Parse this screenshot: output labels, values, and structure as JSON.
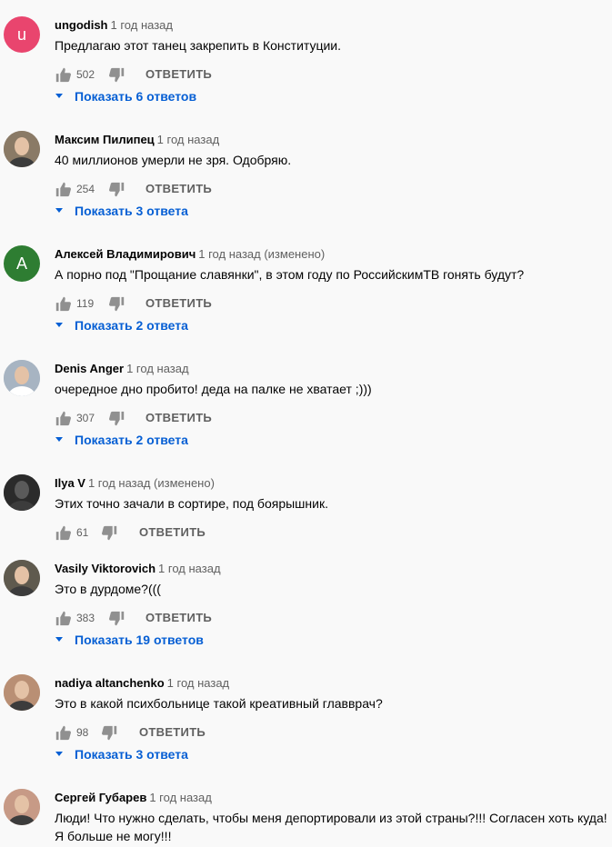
{
  "comments": [
    {
      "author": "ungodish",
      "time": "1 год назад",
      "text": "Предлагаю этот танец закрепить в Конституции.",
      "likes": "502",
      "reply": "ОТВЕТИТЬ",
      "replies_label": "Показать 6 ответов",
      "avatar_letter": "u",
      "avatar_color": "#e9456e"
    },
    {
      "author": "Максим Пилипец",
      "time": "1 год назад",
      "text": "40 миллионов умерли не зря. Одобряю.",
      "likes": "254",
      "reply": "ОТВЕТИТЬ",
      "replies_label": "Показать 3 ответа",
      "avatar_letter": "",
      "avatar_color": "#8a7a66"
    },
    {
      "author": "Алексей Владимирович",
      "time": "1 год назад (изменено)",
      "text": "А порно под \"Прощание славянки\", в этом году по РоссийскимТВ гонять будут?",
      "likes": "119",
      "reply": "ОТВЕТИТЬ",
      "replies_label": "Показать 2 ответа",
      "avatar_letter": "A",
      "avatar_color": "#2e7d32"
    },
    {
      "author": "Denis Anger",
      "time": "1 год назад",
      "text": "очередное дно пробито! деда на палке не хватает ;)))",
      "likes": "307",
      "reply": "ОТВЕТИТЬ",
      "replies_label": "Показать 2 ответа",
      "avatar_letter": "",
      "avatar_color": "#a7b4c2"
    },
    {
      "author": "Ilya V",
      "time": "1 год назад (изменено)",
      "text": "Этих точно зачали в сортире, под боярышник.",
      "likes": "61",
      "reply": "ОТВЕТИТЬ",
      "replies_label": "",
      "avatar_letter": "",
      "avatar_color": "#2b2b2b"
    },
    {
      "author": "Vasily Viktorovich",
      "time": "1 год назад",
      "text": "Это в дурдоме?(((",
      "likes": "383",
      "reply": "ОТВЕТИТЬ",
      "replies_label": "Показать 19 ответов",
      "avatar_letter": "",
      "avatar_color": "#5f5a4e"
    },
    {
      "author": "nadiya altanchenko",
      "time": "1 год назад",
      "text": "Это в какой психбольнице такой креативный главврач?",
      "likes": "98",
      "reply": "ОТВЕТИТЬ",
      "replies_label": "Показать 3 ответа",
      "avatar_letter": "",
      "avatar_color": "#b98f74"
    },
    {
      "author": "Сергей Губарев",
      "time": "1 год назад",
      "text": "Люди! Что нужно сделать, чтобы меня депортировали из этой страны?!!! Согласен хоть куда!\nЯ больше не могу!!!",
      "likes": "",
      "reply": "",
      "replies_label": "",
      "avatar_letter": "",
      "avatar_color": "#c79a86"
    }
  ],
  "icons": {
    "like": "thumbs-up-icon",
    "dislike": "thumbs-down-icon",
    "caret": "caret-down-icon"
  },
  "colors": {
    "link": "#065fd4",
    "secondary_text": "#606060",
    "background": "#f9f9f9"
  }
}
